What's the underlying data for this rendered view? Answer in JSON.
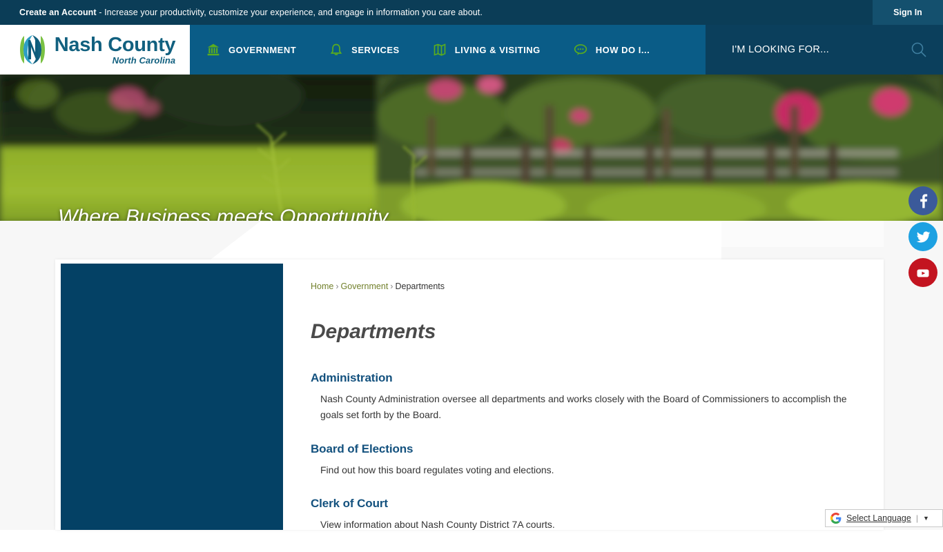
{
  "topbar": {
    "cta_bold": "Create an Account",
    "cta_rest": " - Increase your productivity, customize your experience, and engage in information you care about.",
    "signin_label": "Sign In"
  },
  "logo": {
    "line1": "Nash County",
    "line2": "North Carolina",
    "mark": "nash-county-n-logo"
  },
  "nav": {
    "items": [
      {
        "label": "GOVERNMENT",
        "icon": "bank-icon"
      },
      {
        "label": "SERVICES",
        "icon": "bell-icon"
      },
      {
        "label": "LIVING & VISITING",
        "icon": "map-icon"
      },
      {
        "label": "HOW DO I...",
        "icon": "speech-bubble-icon"
      }
    ],
    "looking_for_label": "I'M LOOKING FOR...",
    "search_icon": "search-icon"
  },
  "hero": {
    "title": "Where Business meets Opportunity"
  },
  "breadcrumb": {
    "home": "Home",
    "government": "Government",
    "current": "Departments",
    "separator": "›"
  },
  "main": {
    "page_title": "Departments",
    "departments": [
      {
        "name": "Administration",
        "description": "Nash County Administration oversee all departments and works closely with the Board of Commissioners to accomplish the goals set forth by the Board."
      },
      {
        "name": "Board of Elections",
        "description": "Find out how this board regulates voting and elections."
      },
      {
        "name": "Clerk of Court",
        "description": "View information about Nash County District 7A courts."
      }
    ]
  },
  "social": [
    {
      "name": "facebook",
      "glyph": "f",
      "color": "#3b5a9a"
    },
    {
      "name": "twitter",
      "glyph": "t",
      "color": "#1da1e2"
    },
    {
      "name": "youtube",
      "glyph": "y",
      "color": "#c31420"
    }
  ],
  "translate": {
    "label": "Select Language",
    "divider": "|",
    "arrow": "▼",
    "brand_icon": "google-g-icon"
  },
  "colors": {
    "topbar": "#0b3d57",
    "navbar": "#0a5c87",
    "looking_for": "#0b3f5c",
    "nav_icon_green": "#5aad1e",
    "side_panel": "#044165",
    "dept_link": "#13517e",
    "breadcrumb_link": "#72802c"
  }
}
